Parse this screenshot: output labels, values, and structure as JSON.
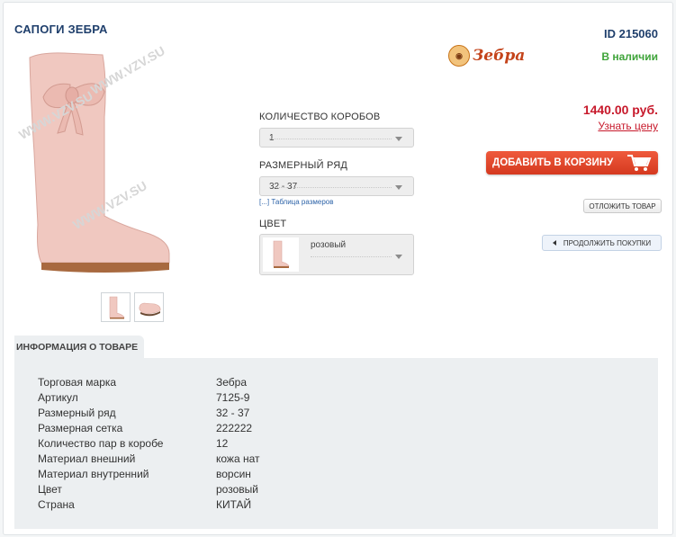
{
  "product": {
    "title": "САПОГИ ЗЕБРА",
    "id_label": "ID 215060",
    "stock": "В наличии",
    "brand": "Зебра",
    "price": "1440.00 руб.",
    "ask_price": "Узнать цену",
    "watermark": "WWW.VZV.SU"
  },
  "options": {
    "boxes_label": "КОЛИЧЕСТВО КОРОБОВ",
    "boxes_value": "1",
    "size_label": "РАЗМЕРНЫЙ РЯД",
    "size_value": "32 - 37",
    "size_table_link": "[...] Таблица размеров",
    "color_label": "ЦВЕТ",
    "color_value": "розовый"
  },
  "buttons": {
    "add_to_cart": "ДОБАВИТЬ В КОРЗИНУ",
    "defer": "ОТЛОЖИТЬ ТОВАР",
    "continue": "ПРОДОЛЖИТЬ ПОКУПКИ"
  },
  "info": {
    "tab": "ИНФОРМАЦИЯ О ТОВАРЕ",
    "specs": [
      {
        "label": "Торговая марка",
        "value": "Зебра"
      },
      {
        "label": "Артикул",
        "value": "7125-9"
      },
      {
        "label": "Размерный ряд",
        "value": "32 - 37"
      },
      {
        "label": "Размерная сетка",
        "value": "222222"
      },
      {
        "label": "Количество пар в коробе",
        "value": "12"
      },
      {
        "label": "Материал внешний",
        "value": "кожа нат"
      },
      {
        "label": "Материал внутренний",
        "value": "ворсин"
      },
      {
        "label": "Цвет",
        "value": "розовый"
      },
      {
        "label": "Страна",
        "value": "КИТАЙ"
      }
    ]
  },
  "colors": {
    "title": "#1f3f6c",
    "stock": "#3fa43a",
    "price": "#c7192b",
    "cart_button": "#e04a2c",
    "boot": "#f0c8c0",
    "sole": "#a8693f"
  },
  "icons": {
    "cart": "shopping-cart-icon",
    "back": "triangle-left-icon",
    "dropdown": "chevron-down-icon"
  }
}
